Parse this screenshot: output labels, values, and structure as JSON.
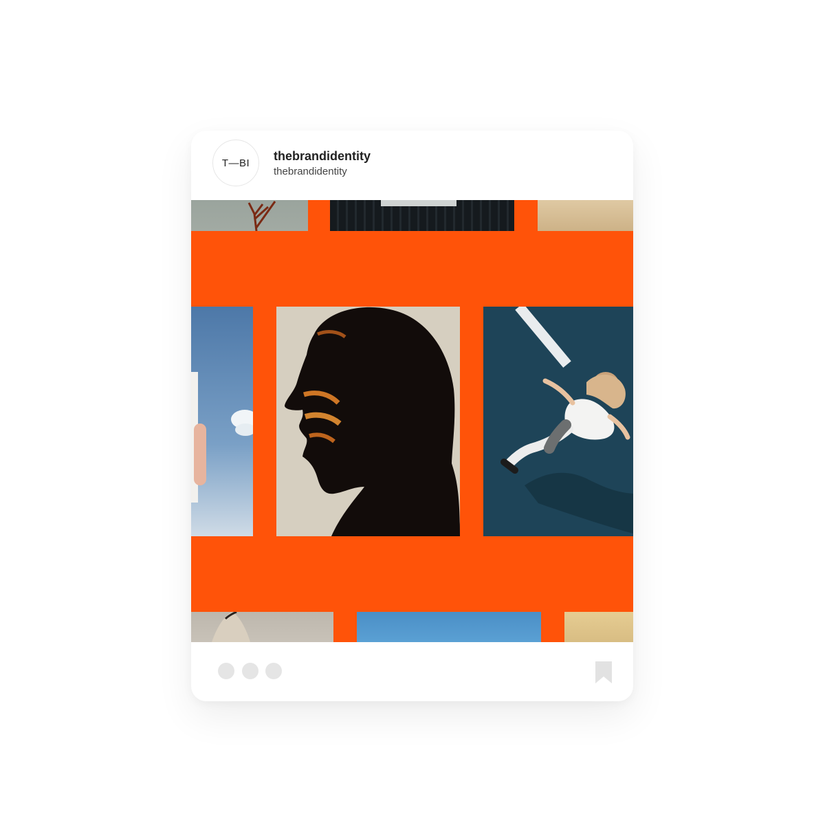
{
  "post": {
    "avatar_text": "T—BI",
    "username": "thebrandidentity",
    "subname": "thebrandidentity"
  },
  "colors": {
    "accent": "#ff5309",
    "dot": "#e5e5e5",
    "bookmark": "#e2e2e2"
  },
  "icons": {
    "pager": [
      "dot",
      "dot",
      "dot"
    ],
    "save": "bookmark-icon"
  }
}
